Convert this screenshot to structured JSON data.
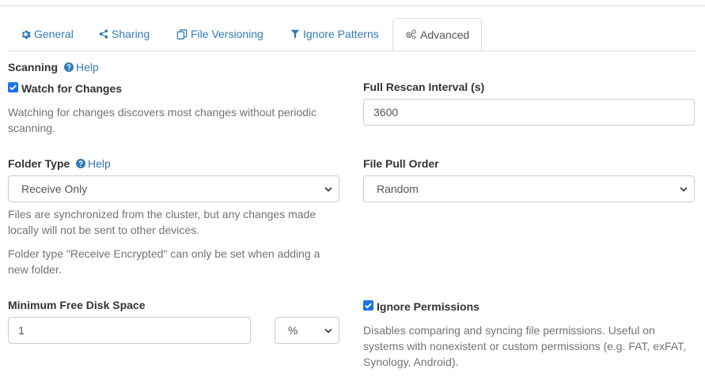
{
  "tabs": [
    {
      "label": "General",
      "icon": "gear-icon"
    },
    {
      "label": "Sharing",
      "icon": "share-icon"
    },
    {
      "label": "File Versioning",
      "icon": "copy-icon"
    },
    {
      "label": "Ignore Patterns",
      "icon": "filter-icon"
    },
    {
      "label": "Advanced",
      "icon": "gears-icon",
      "active": true
    }
  ],
  "scanning": {
    "title": "Scanning",
    "help": "Help",
    "watch_label": "Watch for Changes",
    "watch_checked": true,
    "watch_hint": "Watching for changes discovers most changes without periodic scanning."
  },
  "rescan": {
    "label": "Full Rescan Interval (s)",
    "value": "3600"
  },
  "folder_type": {
    "label": "Folder Type",
    "help": "Help",
    "value": "Receive Only",
    "hint1": "Files are synchronized from the cluster, but any changes made locally will not be sent to other devices.",
    "hint2": "Folder type \"Receive Encrypted\" can only be set when adding a new folder."
  },
  "pull_order": {
    "label": "File Pull Order",
    "value": "Random"
  },
  "min_disk": {
    "label": "Minimum Free Disk Space",
    "value": "1",
    "unit": "%"
  },
  "ignore_perms": {
    "label": "Ignore Permissions",
    "checked": true,
    "hint": "Disables comparing and syncing file permissions. Useful on systems with nonexistent or custom permissions (e.g. FAT, exFAT, Synology, Android)."
  },
  "colors": {
    "link": "#337ab7",
    "hint": "#737373",
    "checkbox": "#1a73e8"
  }
}
